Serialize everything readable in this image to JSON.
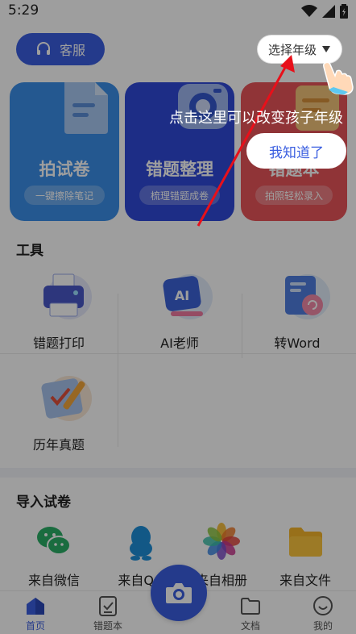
{
  "status": {
    "time": "5:29"
  },
  "header": {
    "service_label": "客服",
    "grade_label": "选择年级"
  },
  "cards": [
    {
      "title": "拍试卷",
      "subtitle": "一键擦除笔记",
      "color": "#3a8ee8"
    },
    {
      "title": "错题整理",
      "subtitle": "梳理错题成卷",
      "color": "#2f49d8"
    },
    {
      "title": "错题本",
      "subtitle": "拍照轻松录入",
      "color": "#e8545a"
    }
  ],
  "tools": {
    "title": "工具",
    "items": [
      {
        "label": "错题打印",
        "icon": "printer-icon"
      },
      {
        "label": "AI老师",
        "icon": "ai-teacher-icon"
      },
      {
        "label": "转Word",
        "icon": "word-doc-icon"
      },
      {
        "label": "历年真题",
        "icon": "exam-clipboard-icon"
      }
    ]
  },
  "import": {
    "title": "导入试卷",
    "items": [
      {
        "label": "来自微信",
        "icon": "wechat-icon"
      },
      {
        "label": "来自QQ",
        "icon": "qq-icon"
      },
      {
        "label": "来自相册",
        "icon": "photos-icon"
      },
      {
        "label": "来自文件",
        "icon": "folder-icon"
      }
    ]
  },
  "tabs": [
    {
      "label": "首页",
      "icon": "home-icon",
      "active": true
    },
    {
      "label": "错题本",
      "icon": "notebook-icon",
      "active": false
    },
    {
      "label": "文档",
      "icon": "document-folder-icon",
      "active": false
    },
    {
      "label": "我的",
      "icon": "profile-face-icon",
      "active": false
    }
  ],
  "guide": {
    "text": "点击这里可以改变孩子年级",
    "ok_label": "我知道了"
  },
  "colors": {
    "accent": "#3a5ee0",
    "arrow": "#e8101a",
    "overlay": "rgba(0,0,0,0.38)"
  }
}
